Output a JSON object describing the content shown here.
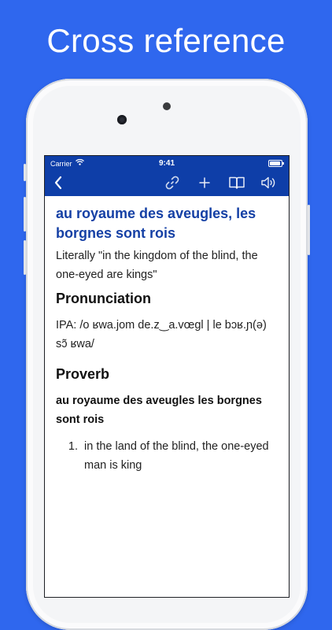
{
  "headline": "Cross reference",
  "status": {
    "carrier": "Carrier",
    "time": "9:41"
  },
  "toolbar": {
    "back_icon": "chevron-left-icon",
    "link_icon": "link-icon",
    "add_icon": "plus-icon",
    "book_icon": "book-icon",
    "speaker_icon": "speaker-icon"
  },
  "entry": {
    "title": "au royaume des aveugles, les borgnes sont rois",
    "literal": "Literally \"in the kingdom of the blind, the one-eyed are kings\"",
    "pronunciation_heading": "Pronunciation",
    "ipa": "IPA: /o ʁwa.jom de.z‿a.vœɡl | le bɔʁ.ɲ(ə) sɔ̃ ʁwa/",
    "pos_heading": "Proverb",
    "term": "au royaume des aveugles les borgnes sont rois",
    "definitions": [
      {
        "number": "1.",
        "text": "in the land of the blind, the one-eyed man is king"
      }
    ]
  },
  "colors": {
    "background": "#2f67ee",
    "navbar": "#0e3ea8",
    "title": "#1540a5"
  }
}
